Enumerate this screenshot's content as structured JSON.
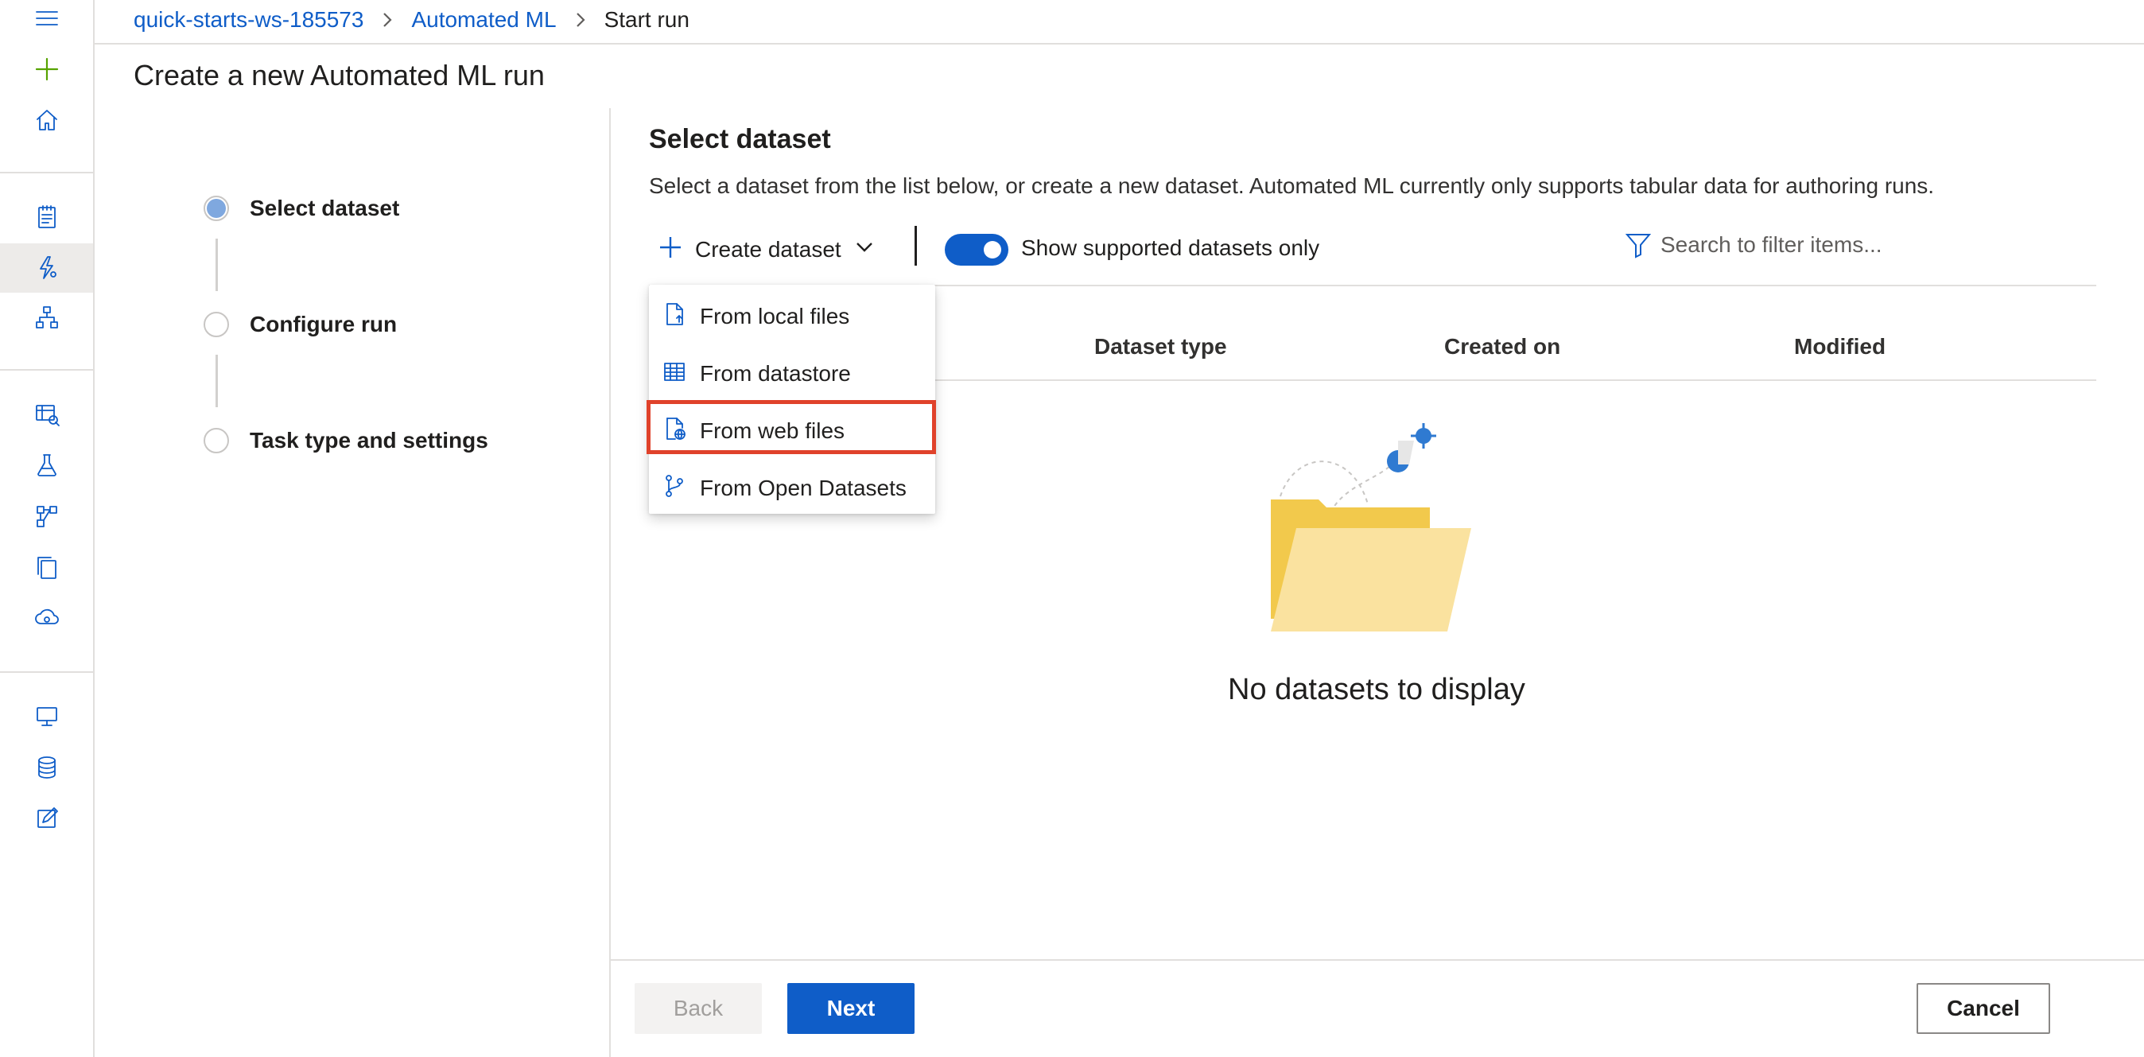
{
  "breadcrumb": {
    "workspace": "quick-starts-ws-185573",
    "section": "Automated ML",
    "current": "Start run"
  },
  "page_title": "Create a new Automated ML run",
  "steps": [
    {
      "label": "Select dataset",
      "state": "current"
    },
    {
      "label": "Configure run",
      "state": "pending"
    },
    {
      "label": "Task type and settings",
      "state": "pending"
    }
  ],
  "main": {
    "title": "Select dataset",
    "description": "Select a dataset from the list below, or create a new dataset. Automated ML currently only supports tabular data for authoring runs."
  },
  "toolbar": {
    "create_label": "Create dataset",
    "toggle_label": "Show supported datasets only",
    "toggle_on": true,
    "search_placeholder": "Search to filter items..."
  },
  "table": {
    "columns": [
      "Dataset type",
      "Created on",
      "Modified"
    ],
    "empty_text": "No datasets to display"
  },
  "create_menu": {
    "items": [
      {
        "label": "From local files",
        "icon": "file-upload-icon"
      },
      {
        "label": "From datastore",
        "icon": "table-icon"
      },
      {
        "label": "From web files",
        "icon": "web-file-icon",
        "highlighted": true
      },
      {
        "label": "From Open Datasets",
        "icon": "branch-icon"
      }
    ]
  },
  "footer": {
    "back_label": "Back",
    "next_label": "Next",
    "cancel_label": "Cancel"
  },
  "colors": {
    "accent": "#0f5dc8",
    "highlight": "#e0422b",
    "add": "#57a300"
  }
}
